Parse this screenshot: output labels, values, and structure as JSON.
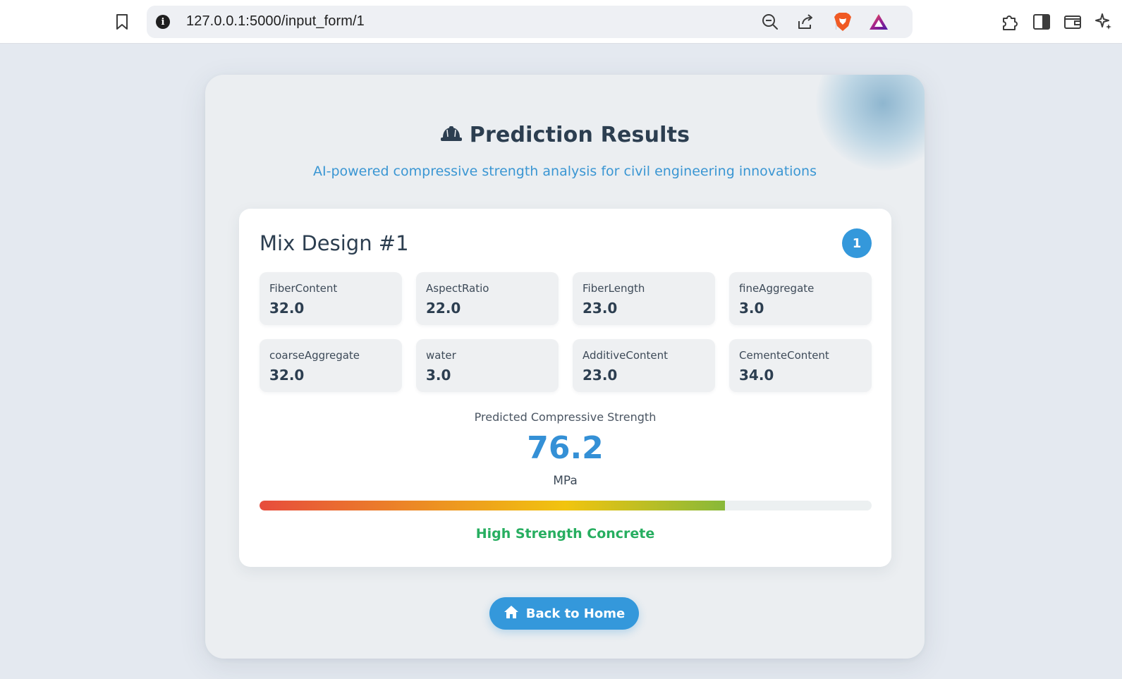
{
  "browser": {
    "url": "127.0.0.1:5000/input_form/1"
  },
  "header": {
    "title": "Prediction Results",
    "subtitle": "AI-powered compressive strength analysis for civil engineering innovations",
    "title_icon": "helmet-icon"
  },
  "mix": {
    "title": "Mix Design #1",
    "badge": "1",
    "params": [
      {
        "label": "FiberContent",
        "value": "32.0"
      },
      {
        "label": "AspectRatio",
        "value": "22.0"
      },
      {
        "label": "FiberLength",
        "value": "23.0"
      },
      {
        "label": "fineAggregate",
        "value": "3.0"
      },
      {
        "label": "coarseAggregate",
        "value": "32.0"
      },
      {
        "label": "water",
        "value": "3.0"
      },
      {
        "label": "AdditiveContent",
        "value": "23.0"
      },
      {
        "label": "CementeContent",
        "value": "34.0"
      }
    ]
  },
  "prediction": {
    "label": "Predicted Compressive Strength",
    "value": "76.2",
    "unit": "MPa",
    "strength_fraction": 0.76,
    "category": "High Strength Concrete",
    "category_color": "#27ae60"
  },
  "actions": {
    "home_label": "Back to Home",
    "home_icon": "home-icon"
  },
  "colors": {
    "accent": "#3498db",
    "text_dark": "#2c3e50"
  }
}
